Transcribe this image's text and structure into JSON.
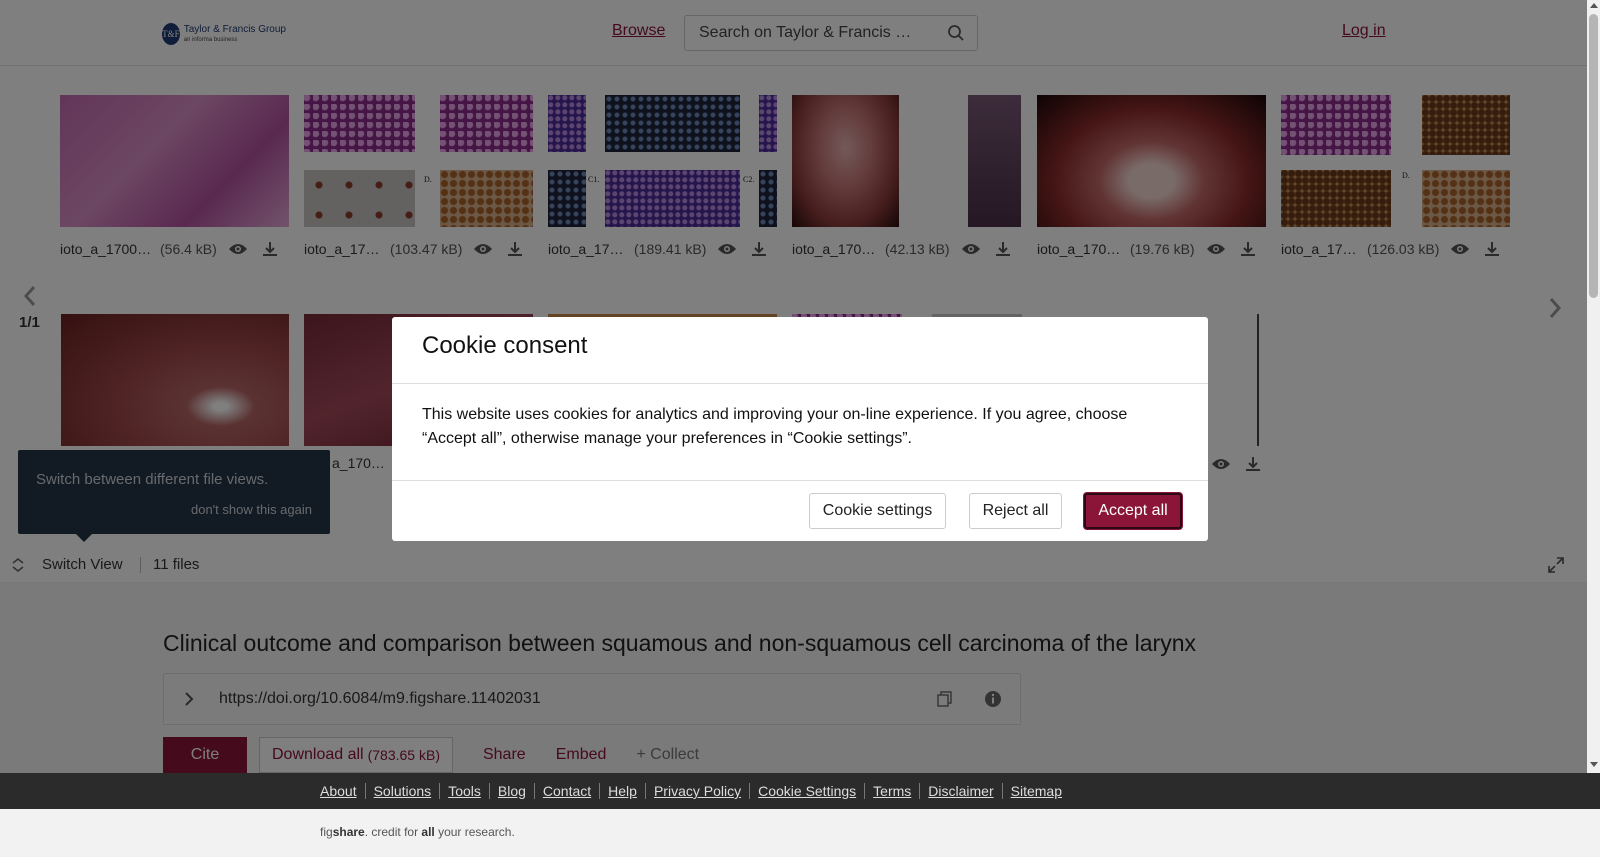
{
  "header": {
    "logo_title": "Taylor & Francis Group",
    "logo_sub": "an informa business",
    "browse_label": "Browse",
    "search_placeholder": "Search on Taylor & Francis …",
    "login_label": "Log in"
  },
  "gallery": {
    "page_indicator": "1/1",
    "row1": [
      {
        "name": "ioto_a_1700…",
        "size": "(56.4 kB)"
      },
      {
        "name": "ioto_a_17…",
        "size": "(103.47 kB)"
      },
      {
        "name": "ioto_a_17…",
        "size": "(189.41 kB)"
      },
      {
        "name": "ioto_a_170…",
        "size": "(42.13 kB)"
      },
      {
        "name": "ioto_a_170…",
        "size": "(19.76 kB)"
      },
      {
        "name": "ioto_a_17…",
        "size": "(126.03 kB)"
      }
    ],
    "row2_caption": "a_170…",
    "panel_labels": [
      "D.",
      "C1.",
      "C2.",
      "D."
    ]
  },
  "tooltip": {
    "text": "Switch between different file views.",
    "dismiss": "don't show this again"
  },
  "switchbar": {
    "label": "Switch View",
    "files": "11 files"
  },
  "item": {
    "title": "Clinical outcome and comparison between squamous and non-squamous cell carcinoma of the larynx",
    "doi": "https://doi.org/10.6084/m9.figshare.11402031",
    "cite": "Cite",
    "download_all": "Download all",
    "download_size": "(783.65 kB)",
    "share": "Share",
    "embed": "Embed",
    "collect": "+ Collect"
  },
  "footer": {
    "links": [
      "About",
      "Solutions",
      "Tools",
      "Blog",
      "Contact",
      "Help",
      "Privacy Policy",
      "Cookie Settings",
      "Terms",
      "Disclaimer",
      "Sitemap"
    ],
    "tagline_pre": "fig",
    "tagline_brand": "share",
    "tagline_mid": ". credit for ",
    "tagline_all": "all",
    "tagline_post": " your research."
  },
  "modal": {
    "title": "Cookie consent",
    "body": "This website uses cookies for analytics and improving your on-line experience. If you agree, choose “Accept all”, otherwise manage your preferences in “Cookie settings”.",
    "settings": "Cookie settings",
    "reject": "Reject all",
    "accept": "Accept all"
  },
  "colors": {
    "brand": "#8a1538",
    "footer_bg": "#2b2b2b",
    "tooltip_bg": "#253446"
  }
}
